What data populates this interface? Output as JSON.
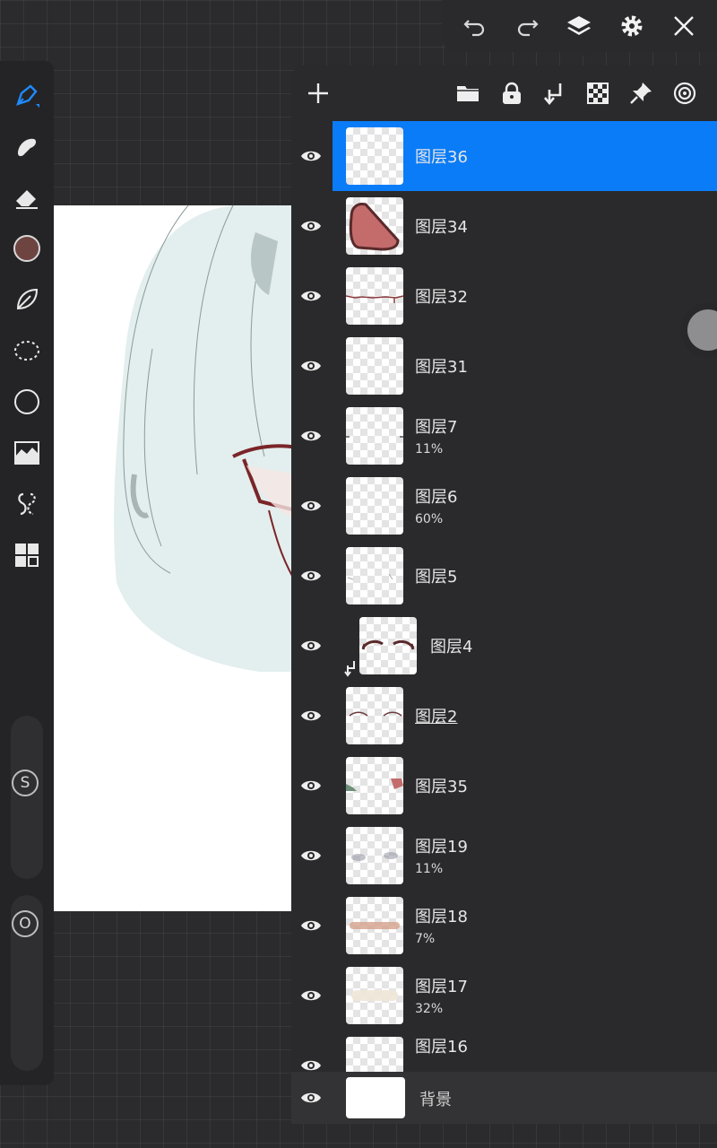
{
  "toolbar": {
    "icons": [
      "undo-icon",
      "redo-icon",
      "layers-icon",
      "settings-icon",
      "close-icon"
    ]
  },
  "left_tools": {
    "icons": [
      "pen-icon",
      "smudge-icon",
      "eraser-icon",
      "color-swatch",
      "lasso-fill-icon",
      "selection-icon",
      "shape-icon",
      "adjust-icon",
      "symmetry-icon",
      "gallery-icon"
    ],
    "current_color": "#6e4441",
    "size_label": "S",
    "opacity_label": "O"
  },
  "layer_panel": {
    "tool_icons": [
      "add-layer-icon",
      "folder-icon",
      "lock-icon",
      "merge-down-icon",
      "alpha-lock-icon",
      "pin-icon",
      "blend-icon"
    ],
    "layers": [
      {
        "name": "图层36",
        "opacity": "",
        "selected": true
      },
      {
        "name": "图层34",
        "opacity": ""
      },
      {
        "name": "图层32",
        "opacity": ""
      },
      {
        "name": "图层31",
        "opacity": ""
      },
      {
        "name": "图层7",
        "opacity": "11%"
      },
      {
        "name": "图层6",
        "opacity": "60%"
      },
      {
        "name": "图层5",
        "opacity": ""
      },
      {
        "name": "图层4",
        "opacity": "",
        "clipped": true
      },
      {
        "name": "图层2",
        "opacity": "",
        "underline": true
      },
      {
        "name": "图层35",
        "opacity": ""
      },
      {
        "name": "图层19",
        "opacity": "11%"
      },
      {
        "name": "图层18",
        "opacity": "7%"
      },
      {
        "name": "图层17",
        "opacity": "32%"
      },
      {
        "name": "图层16",
        "opacity": ""
      }
    ],
    "background_label": "背景"
  },
  "colors": {
    "accent": "#0a7cf7",
    "panel": "#2a2a2c"
  }
}
